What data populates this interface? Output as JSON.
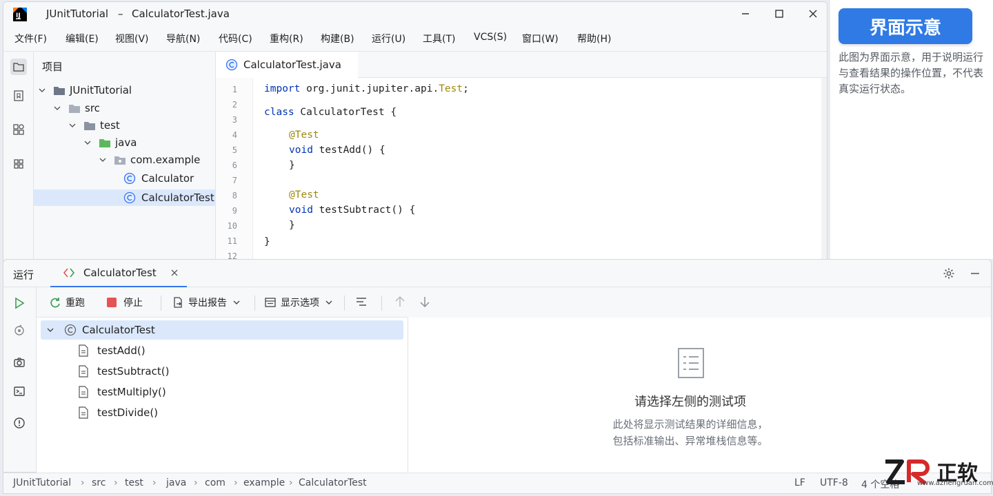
{
  "window": {
    "project_name": "JUnitTutorial",
    "separator": "–",
    "file_name": "CalculatorTest.java"
  },
  "menu": [
    "文件(F)",
    "编辑(E)",
    "视图(V)",
    "导航(N)",
    "代码(C)",
    "重构(R)",
    "构建(B)",
    "运行(U)",
    "工具(T)",
    "VCS(S)",
    "窗口(W)",
    "帮助(H)"
  ],
  "project_panel": {
    "title": "项目",
    "tree": [
      {
        "label": "JUnitTutorial",
        "level": 0,
        "icon": "folder-icon"
      },
      {
        "label": "src",
        "level": 1,
        "icon": "folder-icon"
      },
      {
        "label": "test",
        "level": 2,
        "icon": "folder-icon"
      },
      {
        "label": "java",
        "level": 3,
        "icon": "green-folder-icon"
      },
      {
        "label": "com.example",
        "level": 4,
        "icon": "package-icon"
      },
      {
        "label": "Calculator",
        "level": 5,
        "icon": "class-icon"
      },
      {
        "label": "CalculatorTest",
        "level": 5,
        "icon": "class-icon",
        "selected": true
      }
    ]
  },
  "editor": {
    "tab_label": "CalculatorTest.java",
    "line_numbers": [
      "1",
      "2",
      "3",
      "4",
      "5",
      "6",
      "7",
      "8",
      "9",
      "10",
      "11",
      "12"
    ],
    "code": {
      "l1_kw": "import",
      "l1_rest": " org.junit.jupiter.api.",
      "l1_cls": "Test",
      "l1_end": ";",
      "l3_kw": "class",
      "l3_rest": " CalculatorTest {",
      "l4": "@Test",
      "l5_kw": "void",
      "l5_rest": " testAdd() {",
      "l6": "}",
      "l8": "@Test",
      "l9_kw": "void",
      "l9_rest": " testSubtract() {",
      "l10": "}",
      "l11": "}"
    }
  },
  "run_panel": {
    "title": "运行",
    "tab_label": "CalculatorTest",
    "toolbar": {
      "rerun": "重跑",
      "stop": "停止",
      "export": "导出报告",
      "display": "显示选项"
    },
    "tests": {
      "root": "CalculatorTest",
      "items": [
        "testAdd()",
        "testSubtract()",
        "testMultiply()",
        "testDivide()"
      ]
    },
    "detail": {
      "heading": "请选择左侧的测试项",
      "line1": "此处将显示测试结果的详细信息，",
      "line2": "包括标准输出、异常堆栈信息等。"
    }
  },
  "status_bar": {
    "breadcrumbs": [
      "JUnitTutorial",
      "src",
      "test",
      "java",
      "com",
      "example",
      "CalculatorTest"
    ],
    "line_ending": "LF",
    "encoding": "UTF-8",
    "indent": "4 个空格"
  },
  "side_note": {
    "title": "界面示意",
    "text": "此图为界面示意，用于说明运行与查看结果的操作位置，不代表真实运行状态。"
  },
  "watermark": {
    "brand": "正软",
    "url": "www.azhengruan.com"
  },
  "colors": {
    "accent": "#2f7ae5",
    "keyword": "#0033b3",
    "annotation": "#9e880d",
    "run_green": "#3c9d4f",
    "stop_red": "#e55353",
    "selection": "#dbe8fc"
  }
}
